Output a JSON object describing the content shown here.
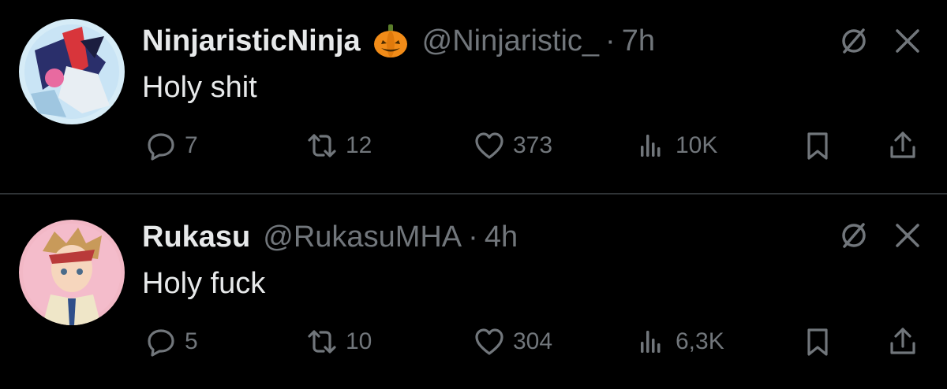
{
  "tweets": [
    {
      "name": "NinjaristicNinja",
      "has_badge_emoji": "jack-o-lantern",
      "handle": "@Ninjaristic_",
      "separator": "·",
      "time": "7h",
      "text": "Holy shit",
      "replies": "7",
      "retweets": "12",
      "likes": "373",
      "views": "10K"
    },
    {
      "name": "Rukasu",
      "handle": "@RukasuMHA",
      "separator": "·",
      "time": "4h",
      "text": "Holy fuck",
      "replies": "5",
      "retweets": "10",
      "likes": "304",
      "views": "6,3K"
    }
  ],
  "colors": {
    "background": "#000000",
    "primary_text": "#e7e9ea",
    "secondary_text": "#71767b",
    "divider": "#2f3336"
  },
  "icons": [
    "muted-conversation-icon",
    "close-icon",
    "reply-icon",
    "retweet-icon",
    "like-icon",
    "views-icon",
    "bookmark-icon",
    "share-icon"
  ]
}
